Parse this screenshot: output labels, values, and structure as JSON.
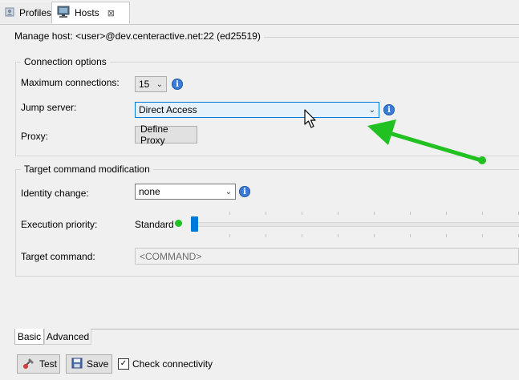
{
  "tabs": [
    {
      "label": "Profiles",
      "icon": "profiles-icon",
      "active": false
    },
    {
      "label": "Hosts",
      "icon": "hosts-icon",
      "active": true,
      "close": "⊠"
    }
  ],
  "header": {
    "label": "Manage host:",
    "host": "<user>@dev.centeractive.net:22 (ed25519)"
  },
  "connection": {
    "title": "Connection options",
    "max_label": "Maximum connections:",
    "max_value": "15",
    "jump_label": "Jump server:",
    "jump_value": "Direct Access",
    "proxy_label": "Proxy:",
    "proxy_button": "Define Proxy"
  },
  "target": {
    "title": "Target command modification",
    "identity_label": "Identity change:",
    "identity_value": "none",
    "priority_label": "Execution priority:",
    "priority_value": "Standard",
    "priority_level": 0,
    "command_label": "Target command:",
    "command_placeholder": "<COMMAND>"
  },
  "bottom_tabs": [
    {
      "label": "Basic",
      "active": true
    },
    {
      "label": "Advanced",
      "active": false
    }
  ],
  "actions": {
    "test_label": "Test",
    "save_label": "Save",
    "check_label": "Check connectivity",
    "check_checked": true
  },
  "colors": {
    "accent": "#0078d7",
    "annotation_arrow": "#22c122",
    "status_dot": "#22c122",
    "info": "#3a7bd5"
  }
}
